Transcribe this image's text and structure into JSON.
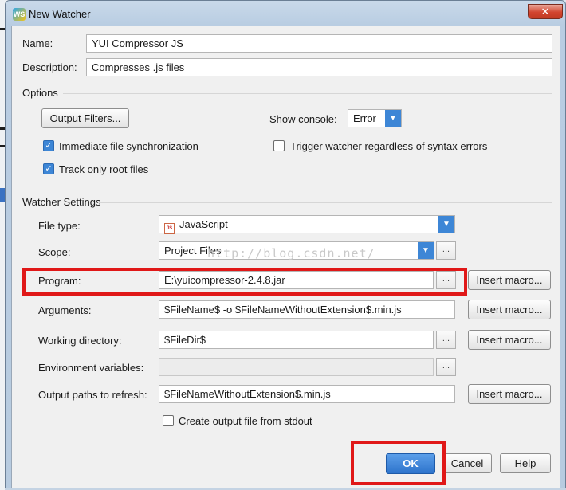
{
  "window": {
    "title": "New Watcher",
    "close_glyph": "✕",
    "app_icon": "webstorm-icon"
  },
  "name": {
    "label": "Name:",
    "value": "YUI Compressor JS"
  },
  "description": {
    "label": "Description:",
    "value": "Compresses .js files"
  },
  "options": {
    "heading": "Options",
    "output_filters_label": "Output Filters...",
    "show_console_label": "Show console:",
    "show_console_value": "Error",
    "immediate_sync_label": "Immediate file synchronization",
    "immediate_sync_checked": true,
    "trigger_label": "Trigger watcher regardless of syntax errors",
    "trigger_checked": false,
    "track_root_label": "Track only root files",
    "track_root_checked": true
  },
  "watcher": {
    "heading": "Watcher Settings",
    "file_type_label": "File type:",
    "file_type_value": "JavaScript",
    "scope_label": "Scope:",
    "scope_value": "Project Files",
    "program_label": "Program:",
    "program_value": "E:\\yuicompressor-2.4.8.jar",
    "arguments_label": "Arguments:",
    "arguments_value": "$FileName$ -o $FileNameWithoutExtension$.min.js",
    "working_dir_label": "Working directory:",
    "working_dir_value": "$FileDir$",
    "env_label": "Environment variables:",
    "env_value": "",
    "output_paths_label": "Output paths to refresh:",
    "output_paths_value": "$FileNameWithoutExtension$.min.js",
    "stdout_label": "Create output file from stdout",
    "stdout_checked": false,
    "browse_label": "...",
    "insert_macro_label": "Insert macro..."
  },
  "buttons": {
    "ok": "OK",
    "cancel": "Cancel",
    "help": "Help"
  },
  "watermark": "http://blog.csdn.net/",
  "colors": {
    "accent": "#3d86d6",
    "highlight": "#e01818"
  }
}
